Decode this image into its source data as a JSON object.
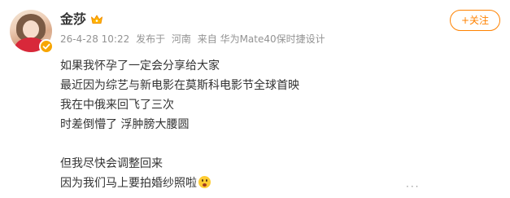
{
  "user": {
    "name": "金莎",
    "avatar_icon": "avatar",
    "verified_icon": "verified-badge-icon",
    "vip_icon": "crown-icon"
  },
  "meta": {
    "timestamp": "26-4-28 10:22",
    "published_label": "发布于",
    "location": "河南",
    "source": "来自 华为Mate40保时捷设计"
  },
  "follow": {
    "label": "+关注",
    "color": "#ff8200"
  },
  "post": {
    "lines": [
      "如果我怀孕了一定会分享给大家",
      "最近因为综艺与新电影在莫斯科电影节全球首映",
      "我在中俄来回飞了三次",
      "时差倒懵了 浮肿膀大腰圆",
      "",
      "但我尽快会调整回来",
      "因为我们马上要拍婚纱照啦"
    ],
    "trailing_emoji": "surprised-face-icon"
  },
  "more": {
    "label": "···"
  },
  "colors": {
    "accent": "#ff8200",
    "meta_text": "#939393",
    "body_text": "#333333",
    "badge": "#f7a500"
  }
}
